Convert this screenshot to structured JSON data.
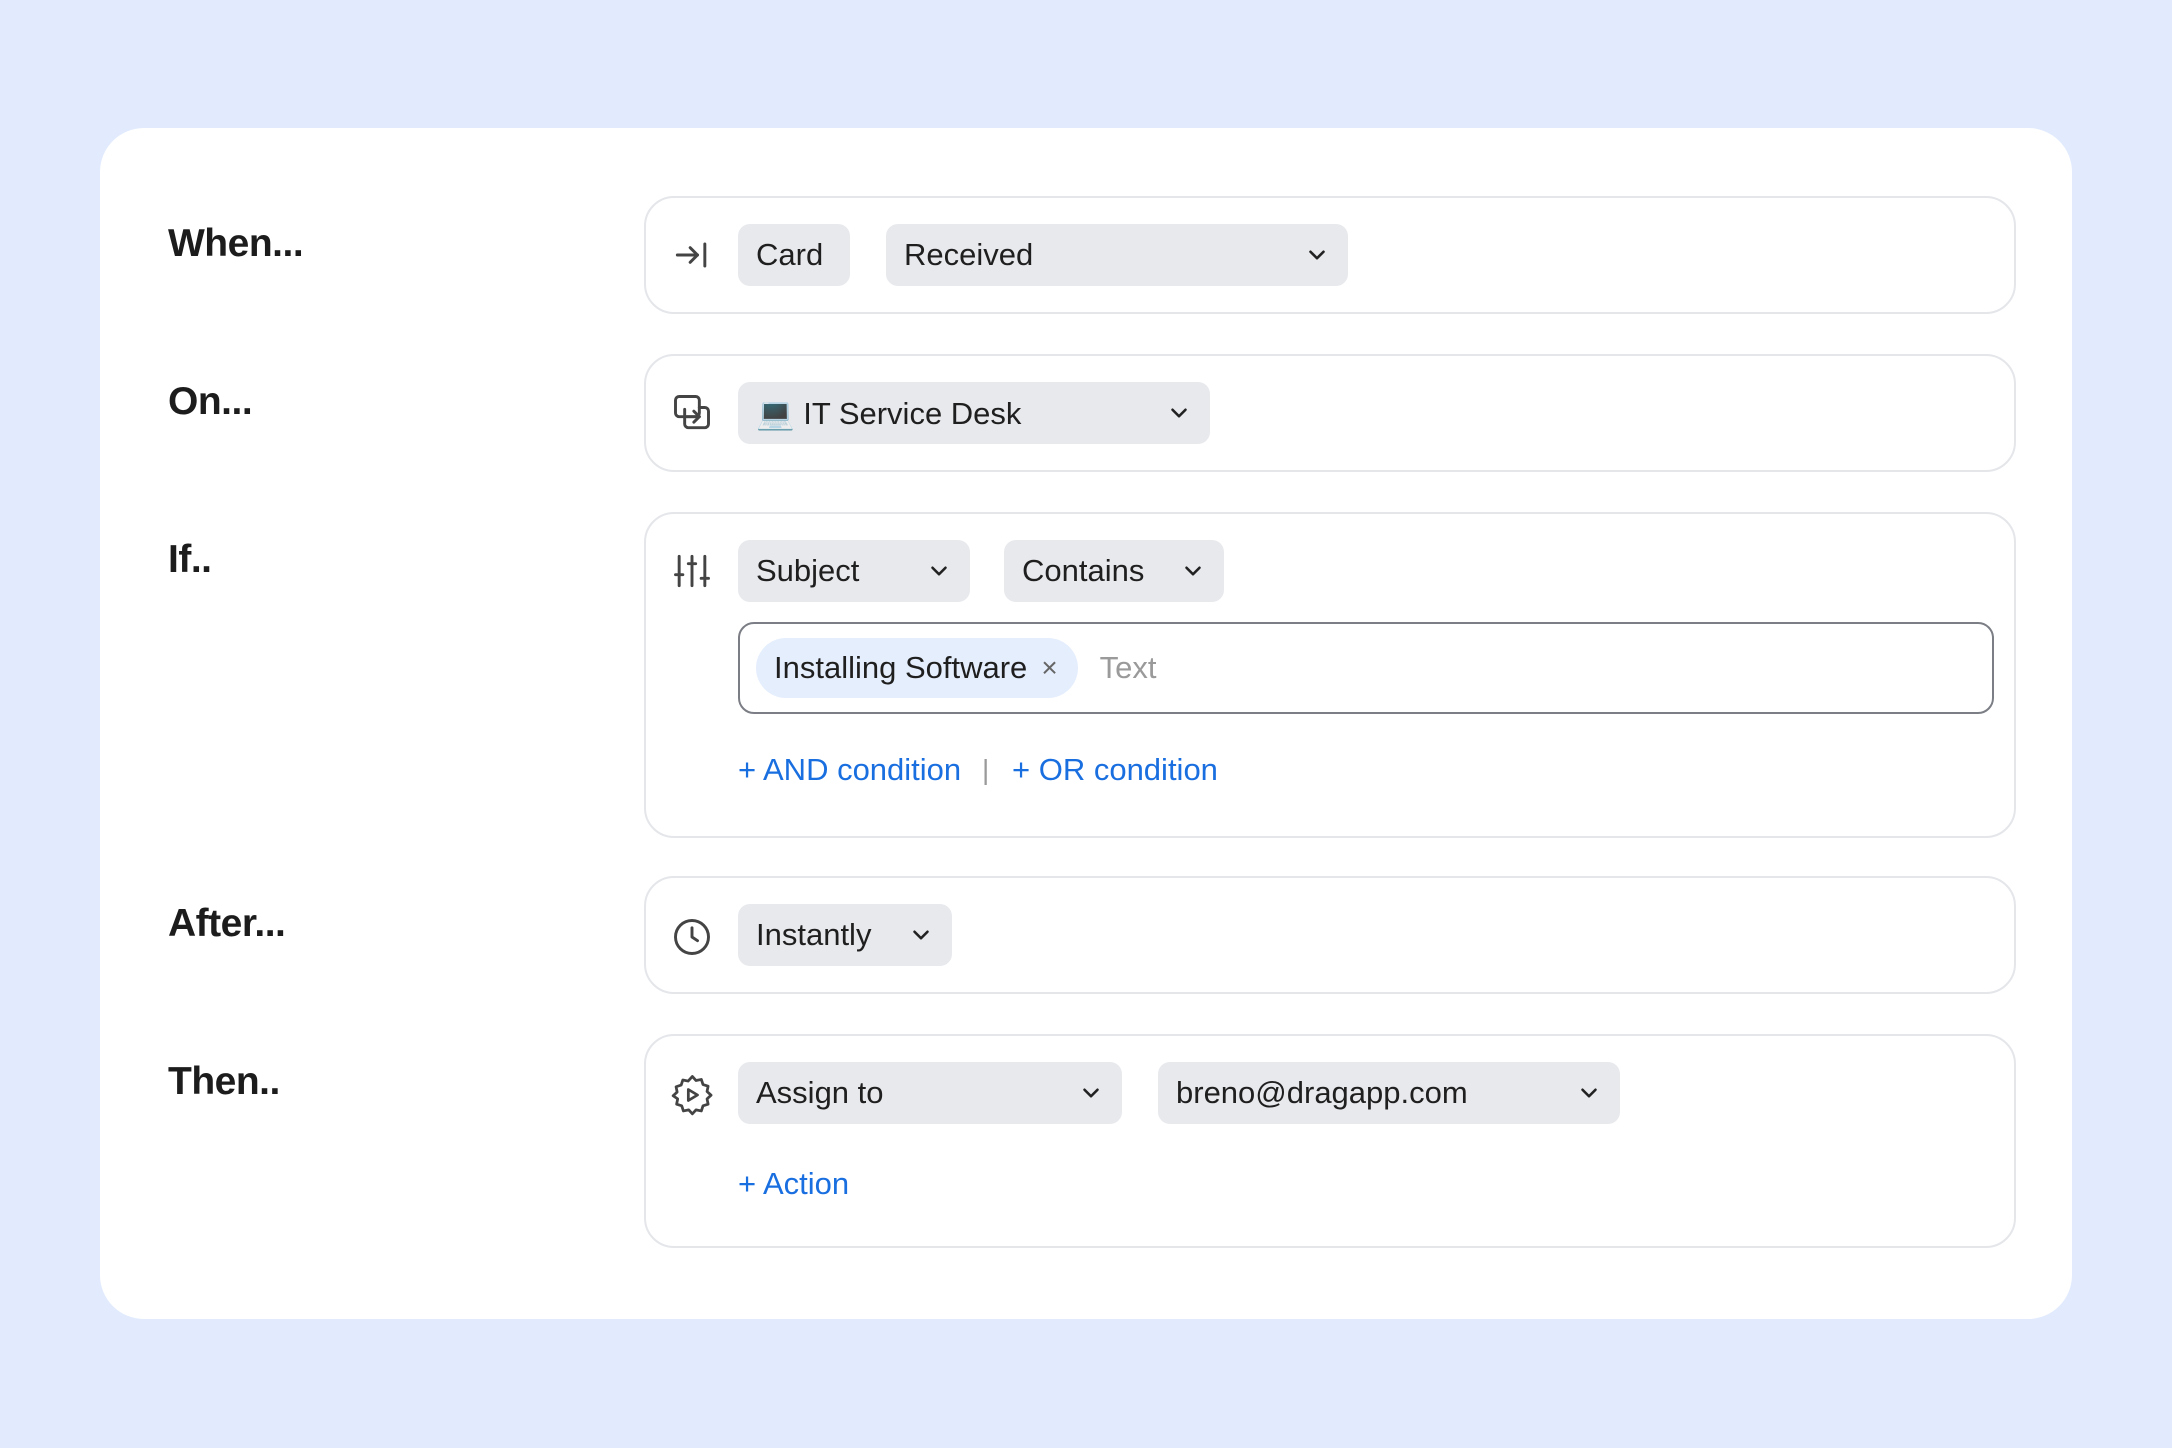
{
  "rows": {
    "when": {
      "label": "When...",
      "icon": "arrow-right-to-bar-icon",
      "object": "Card",
      "event": "Received"
    },
    "on": {
      "label": "On...",
      "icon": "switch-board-icon",
      "board": "💻 IT Service Desk"
    },
    "if": {
      "label": "If..",
      "icon": "sliders-icon",
      "field": "Subject",
      "operator": "Contains",
      "tag": "Installing Software",
      "tag_remove": "×",
      "input_placeholder": "Text",
      "and_condition": "+ AND condition",
      "separator": "|",
      "or_condition": "+ OR condition"
    },
    "after": {
      "label": "After...",
      "icon": "clock-icon",
      "delay": "Instantly"
    },
    "then": {
      "label": "Then..",
      "icon": "gear-play-icon",
      "action": "Assign to",
      "assignee": "breno@dragapp.com",
      "add_action": "+ Action"
    }
  },
  "colors": {
    "background": "#e1ebfd",
    "card": "#ffffff",
    "pill": "#e8e9ed",
    "chip": "#e5eefd",
    "link": "#1a6fe0",
    "border": "#e4e6ea"
  }
}
